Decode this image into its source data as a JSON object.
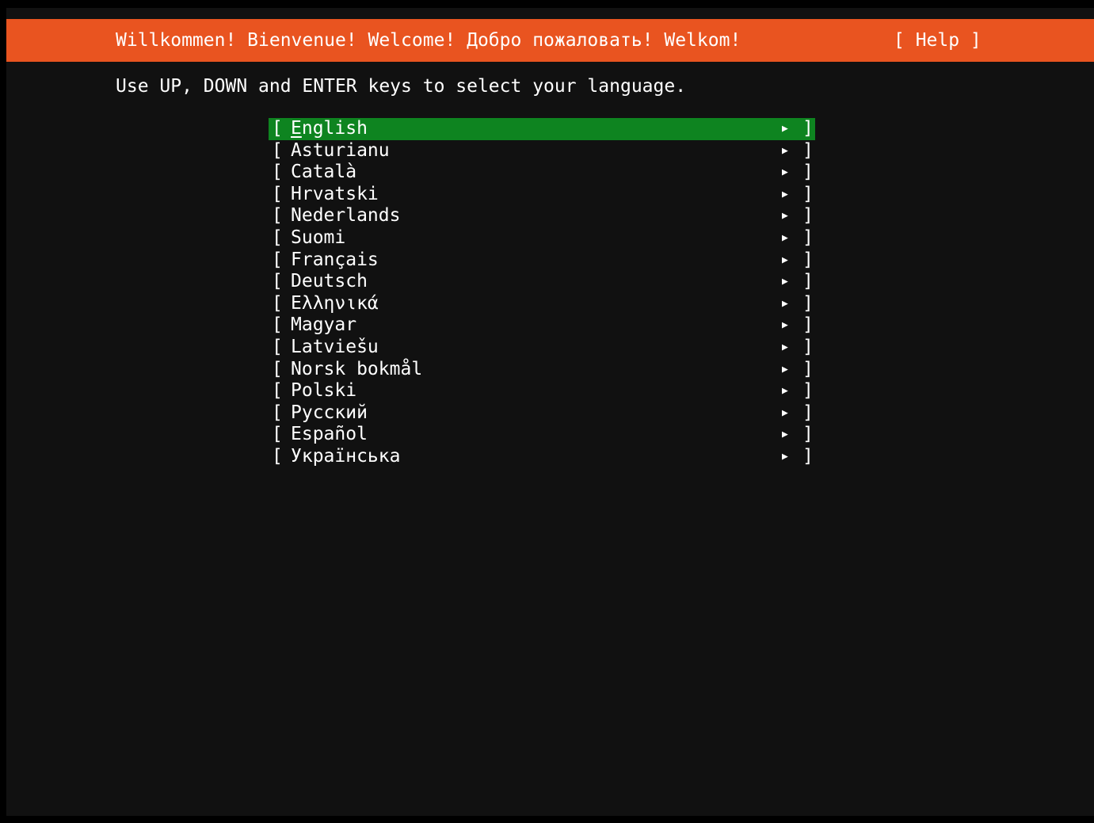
{
  "header": {
    "title": "Willkommen! Bienvenue! Welcome! Добро пожаловать! Welkom!",
    "help_label": "[ Help ]"
  },
  "instructions": "Use UP, DOWN and ENTER keys to select your language.",
  "languages": {
    "selected_index": 0,
    "bracket_open": "[",
    "bracket_close": "]",
    "arrow_icon": "▶",
    "items": [
      {
        "label": "English"
      },
      {
        "label": "Asturianu"
      },
      {
        "label": "Català"
      },
      {
        "label": "Hrvatski"
      },
      {
        "label": "Nederlands"
      },
      {
        "label": "Suomi"
      },
      {
        "label": "Français"
      },
      {
        "label": "Deutsch"
      },
      {
        "label": "Ελληνικά"
      },
      {
        "label": "Magyar"
      },
      {
        "label": "Latviešu"
      },
      {
        "label": "Norsk bokmål"
      },
      {
        "label": "Polski"
      },
      {
        "label": "Русский"
      },
      {
        "label": "Español"
      },
      {
        "label": "Українська"
      }
    ]
  },
  "colors": {
    "header_bg": "#e95420",
    "selected_bg": "#0e8420",
    "screen_bg": "#111111",
    "text": "#ffffff"
  }
}
